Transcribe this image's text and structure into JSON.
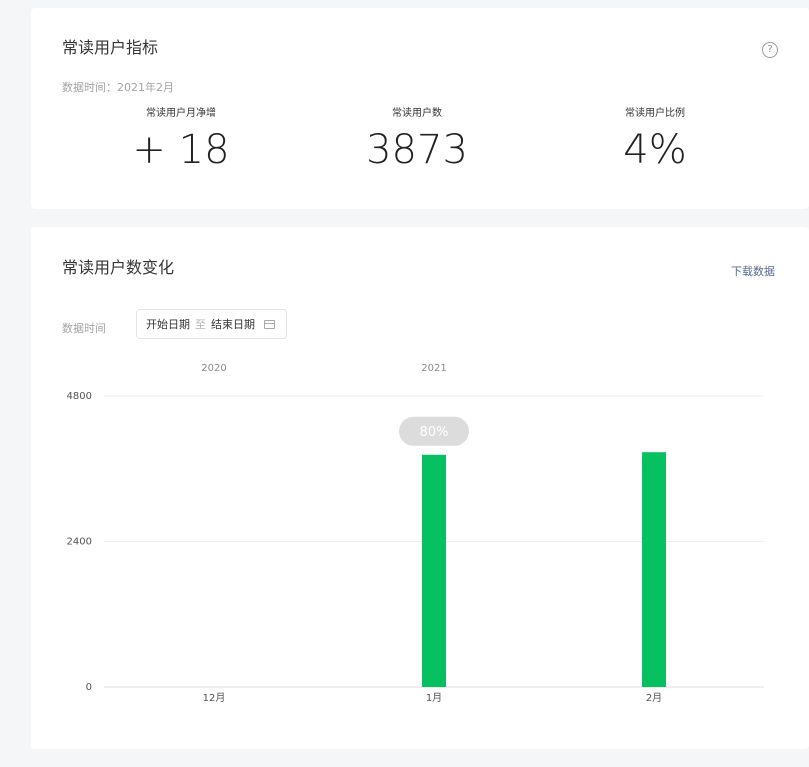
{
  "metrics_card": {
    "title": "常读用户指标",
    "help_icon": "?",
    "data_time": "数据时间：2021年2月",
    "metrics": [
      {
        "label": "常读用户月净增",
        "value": "+ 18"
      },
      {
        "label": "常读用户数",
        "value": "3873"
      },
      {
        "label": "常读用户比例",
        "value": "4%"
      }
    ]
  },
  "trend_card": {
    "title": "常读用户数变化",
    "download_label": "下载数据",
    "range_label": "数据时间",
    "date_start_placeholder": "开始日期",
    "date_separator": "至",
    "date_end_placeholder": "结束日期"
  },
  "chart_data": {
    "type": "bar",
    "categories": [
      "12月",
      "1月",
      "2月"
    ],
    "year_labels": [
      "2020",
      "2021"
    ],
    "values": [
      0,
      3830,
      3873
    ],
    "yticks": [
      0,
      2400,
      4800
    ],
    "ylim": [
      0,
      4800
    ],
    "grid": true,
    "tooltip": "80%",
    "bar_color": "#07c160"
  },
  "colors": {
    "accent": "#07c160",
    "link": "#576b95"
  }
}
